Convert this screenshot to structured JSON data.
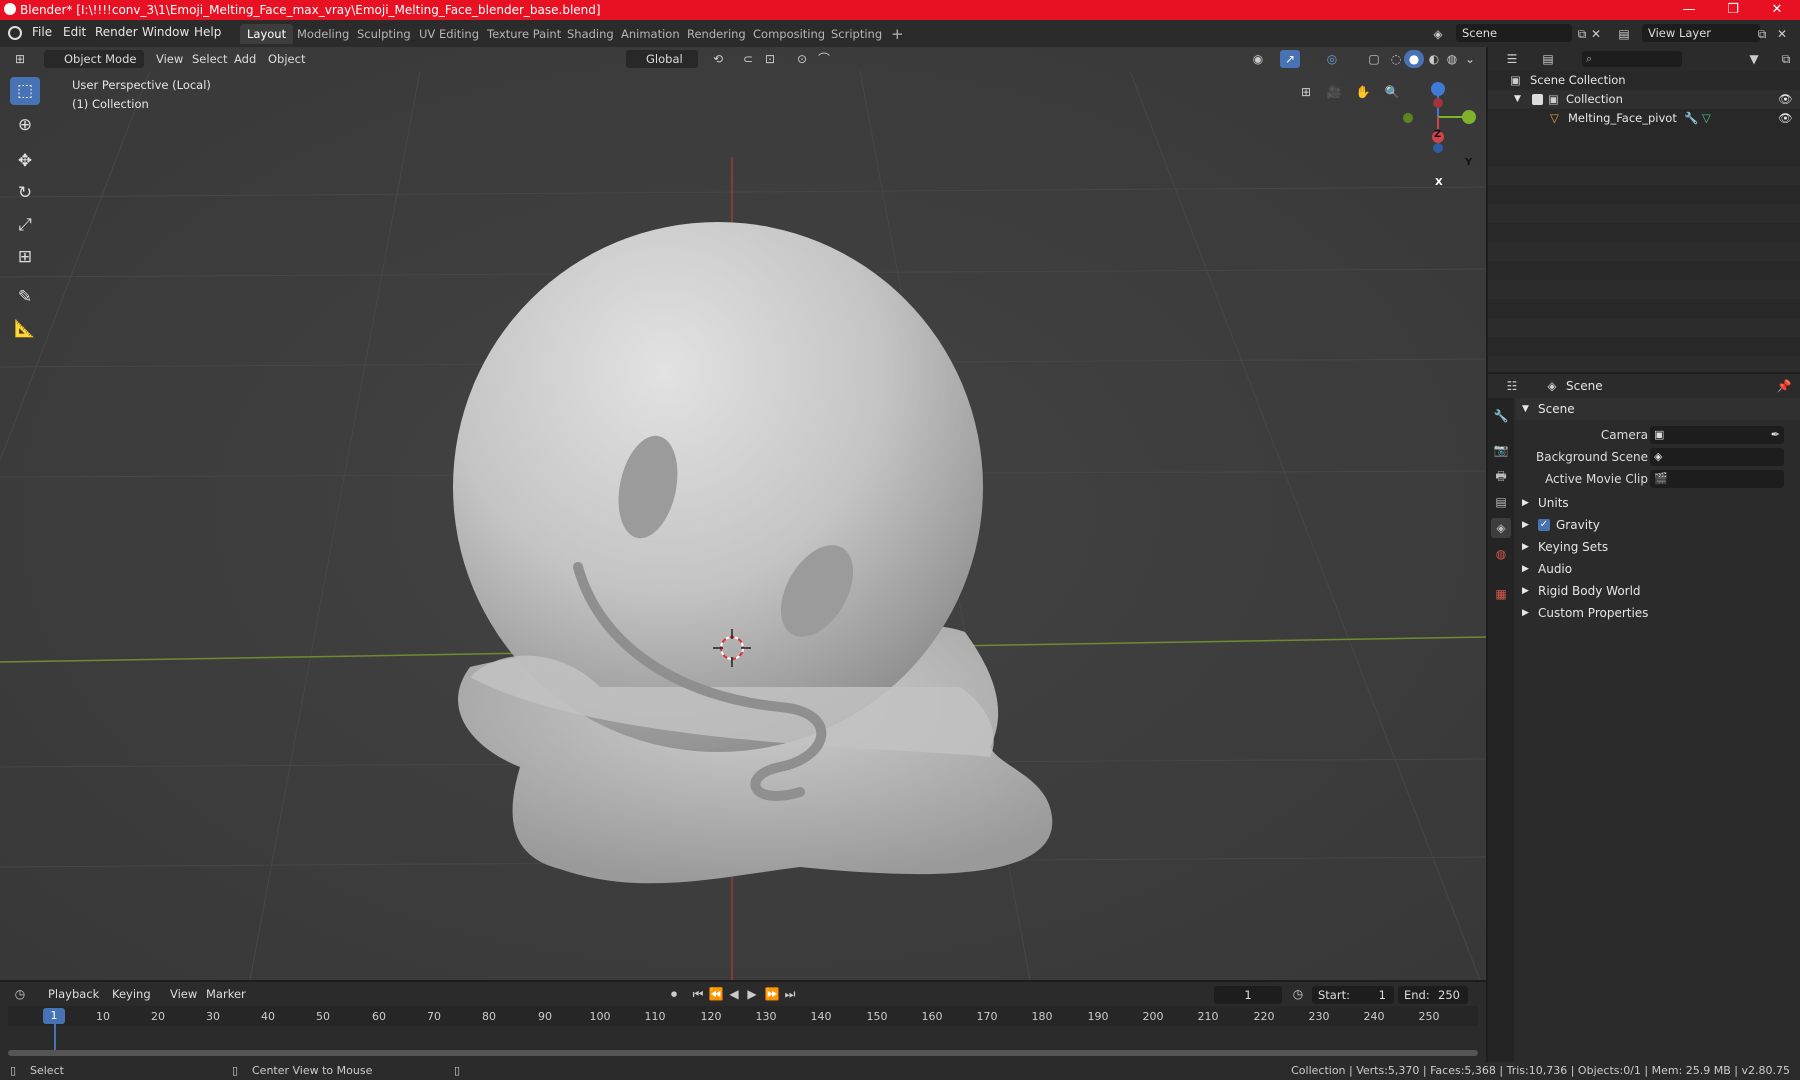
{
  "window": {
    "title": "Blender* [I:\\!!!!conv_3\\1\\Emoji_Melting_Face_max_vray\\Emoji_Melting_Face_blender_base.blend]",
    "minimize": "—",
    "maximize": "❐",
    "close": "✕"
  },
  "menu": {
    "file": "File",
    "edit": "Edit",
    "render": "Render",
    "window": "Window",
    "help": "Help"
  },
  "workspaces": [
    "Layout",
    "Modeling",
    "Sculpting",
    "UV Editing",
    "Texture Paint",
    "Shading",
    "Animation",
    "Rendering",
    "Compositing",
    "Scripting"
  ],
  "scene_field": "Scene",
  "view_layer_field": "View Layer",
  "viewport": {
    "mode": "Object Mode",
    "view": "View",
    "select": "Select",
    "add": "Add",
    "object": "Object",
    "transform_orientation": "Global",
    "perspective_label": "User Perspective (Local)",
    "collection_label": "(1) Collection",
    "gizmo_z": "Z",
    "gizmo_y": "Y",
    "gizmo_x": "X"
  },
  "outliner": {
    "scene_collection": "Scene Collection",
    "collection": "Collection",
    "object": "Melting_Face_pivot"
  },
  "properties": {
    "header": "Scene",
    "panel": "Scene",
    "camera_label": "Camera",
    "background_scene_label": "Background Scene",
    "active_movie_clip_label": "Active Movie Clip",
    "sections": [
      "Units",
      "Gravity",
      "Keying Sets",
      "Audio",
      "Rigid Body World",
      "Custom Properties"
    ]
  },
  "timeline": {
    "playback": "Playback",
    "keying": "Keying",
    "view": "View",
    "marker": "Marker",
    "current_frame": "1",
    "start_label": "Start:",
    "start": "1",
    "end_label": "End:",
    "end": "250",
    "current_marker": "1",
    "ticks": [
      "10",
      "20",
      "30",
      "40",
      "50",
      "60",
      "70",
      "80",
      "90",
      "100",
      "110",
      "120",
      "130",
      "140",
      "150",
      "160",
      "170",
      "180",
      "190",
      "200",
      "210",
      "220",
      "230",
      "240",
      "250"
    ]
  },
  "status": {
    "select": "Select",
    "center_view": "Center View to Mouse",
    "stats": "Collection | Verts:5,370 | Faces:5,368 | Tris:10,736 | Objects:0/1 | Mem: 25.9 MB | v2.80.75"
  }
}
